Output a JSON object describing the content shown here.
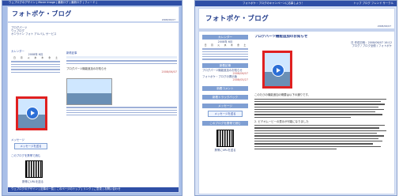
{
  "left": {
    "topbar": "ウェブログのデザイン  | Movie Image  | 最新ログ  | 最新ログ  | フィード  |",
    "title": "フォトポケ・ブログ",
    "date_line": "2008/06/07",
    "side_links": [
      "ブログパーツ",
      "ウェブログ",
      "オンライン フォト アルバム サービス"
    ],
    "calendar_head": "カレンダー",
    "calendar_month": "2008年 6月",
    "days_header": [
      "日",
      "月",
      "火",
      "水",
      "木",
      "金",
      "土"
    ],
    "entries_head": "新着記事",
    "post_title": "ブログパーツ機能追加のお知らせ",
    "post_date": "2008/06/07",
    "footer": "ウェブログのデザイン | 記事の一覧 | このページのトップ | リンク  |  ご意見  |  お問い合わせ",
    "message_head": "メッセージ",
    "message_button": "メッセージを送る",
    "mobile_head": "このブログを携帯で読む",
    "mobile_link": "携帯にURLを送る"
  },
  "right": {
    "topbar_center": "フォトポケ・ブログのキャンペーンに応募しよう！",
    "topbar_links": "トップ  ブログ  フレンド  サークル",
    "title": "フォトポケ・ブログ",
    "date_line": "2008/06/07",
    "calendar_head": "カレンダー",
    "calendar_month": "2008年 6月",
    "days_header": [
      "日",
      "月",
      "火",
      "水",
      "木",
      "金",
      "土"
    ],
    "entries_head": "新着記事",
    "entries": [
      "ブログパーツ機能追加のお知らせ",
      "2008/06/07",
      "フォトポケ・ブログの掲示版",
      "2008/05/27"
    ],
    "comments_head": "新着コメント",
    "trackback_head": "新着トラックバック",
    "message_head": "メッセージ",
    "message_button": "メッセージを送る",
    "mobile_head": "このブログを携帯で読む",
    "mobile_link": "携帯にURLを送る",
    "post_title": "ブログパーツ機能追加のお知らせ",
    "post_meta": "日  作成日時：2008/06/07  16:12",
    "post_meta2": "ブログ / ブログ全般 / フォトポケ",
    "post_intro": "このたびの機能追加の概要は以下の通りです。",
    "post_point": "2. ビデオムービーの表示が可能になりました"
  }
}
